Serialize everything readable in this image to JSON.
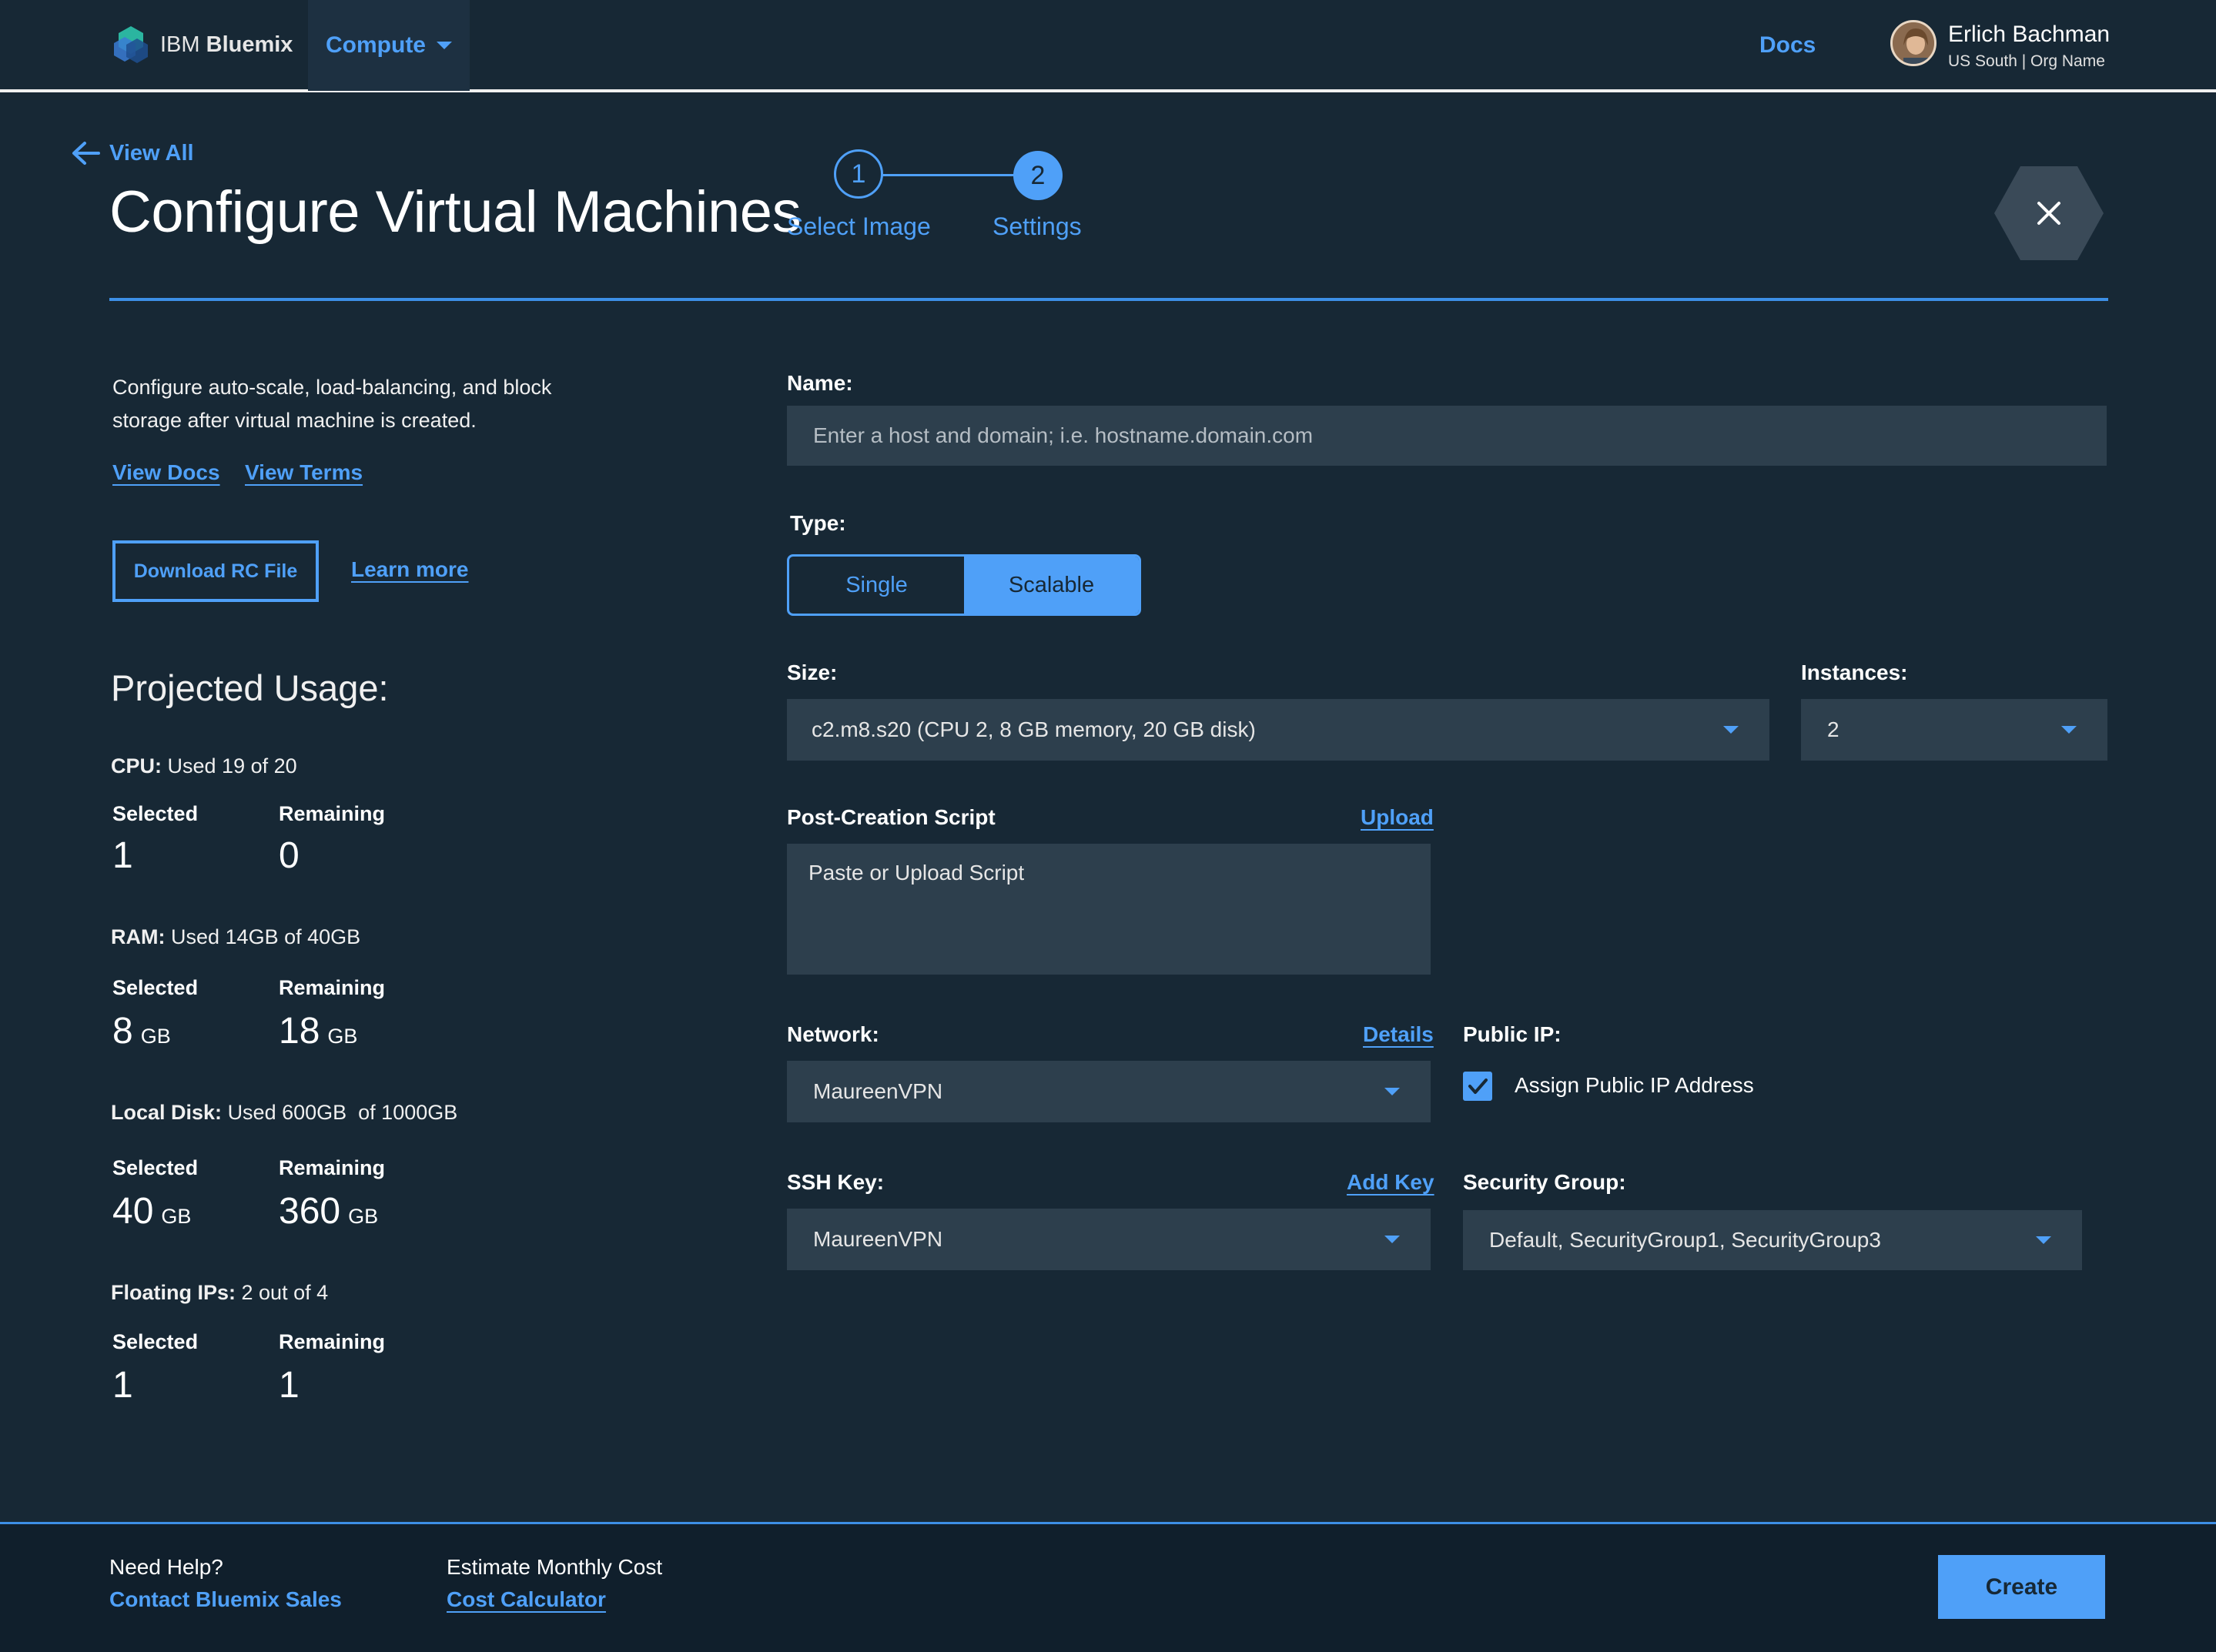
{
  "header": {
    "brand_prefix": "IBM",
    "brand_name": "Bluemix",
    "logo_icon": "bluemix-hexagon-logo-icon",
    "menu_label": "Compute",
    "docs_label": "Docs",
    "user_name": "Erlich Bachman",
    "user_org": "US South | Org Name"
  },
  "page": {
    "back_label": "View All",
    "title": "Configure Virtual Machines",
    "steps": [
      {
        "number": "1",
        "label": "Select Image",
        "state": "complete"
      },
      {
        "number": "2",
        "label": "Settings",
        "state": "active"
      }
    ],
    "close_icon": "close-icon"
  },
  "sidebar": {
    "intro_line1": "Configure auto-scale, load-balancing, and block",
    "intro_line2": "storage after virtual machine is created.",
    "view_docs": "View Docs",
    "view_terms": "View Terms",
    "download_button": "Download RC File",
    "learn_more": "Learn more",
    "usage_title": "Projected Usage:",
    "selected_label": "Selected",
    "remaining_label": "Remaining",
    "usage": [
      {
        "name": "CPU:",
        "detail": "Used 19 of 20",
        "selected": "1",
        "selected_unit": "",
        "remaining": "0",
        "remaining_unit": ""
      },
      {
        "name": "RAM:",
        "detail": "Used 14GB of 40GB",
        "selected": "8",
        "selected_unit": "GB",
        "remaining": "18",
        "remaining_unit": "GB"
      },
      {
        "name": "Local Disk:",
        "detail": "Used 600GB  of 1000GB",
        "selected": "40",
        "selected_unit": "GB",
        "remaining": "360",
        "remaining_unit": "GB"
      },
      {
        "name": "Floating IPs:",
        "detail": "2 out of 4",
        "selected": "1",
        "selected_unit": "",
        "remaining": "1",
        "remaining_unit": ""
      }
    ]
  },
  "form": {
    "name_label": "Name:",
    "name_placeholder": "Enter a host and domain; i.e. hostname.domain.com",
    "type_label": "Type:",
    "type_options": [
      "Single",
      "Scalable"
    ],
    "type_selected": "Scalable",
    "size_label": "Size:",
    "size_value": "c2.m8.s20 (CPU 2, 8 GB memory, 20 GB disk)",
    "instances_label": "Instances:",
    "instances_value": "2",
    "script_label": "Post-Creation Script",
    "script_upload": "Upload",
    "script_placeholder": "Paste or Upload Script",
    "network_label": "Network:",
    "network_details": "Details",
    "network_value": "MaureenVPN",
    "public_ip_label": "Public IP:",
    "public_ip_option": "Assign Public IP Address",
    "public_ip_checked": true,
    "ssh_label": "SSH Key:",
    "ssh_add": "Add Key",
    "ssh_value": "MaureenVPN",
    "security_label": "Security Group:",
    "security_value": "Default, SecurityGroup1, SecurityGroup3"
  },
  "footer": {
    "help_text": "Need Help?",
    "help_link": "Contact Bluemix Sales",
    "cost_text": "Estimate Monthly Cost",
    "cost_link": "Cost Calculator",
    "create_button": "Create"
  },
  "colors": {
    "background": "#172835",
    "accent": "#4fa0f8",
    "field": "#2d3f4d",
    "footer": "#101f2c"
  }
}
